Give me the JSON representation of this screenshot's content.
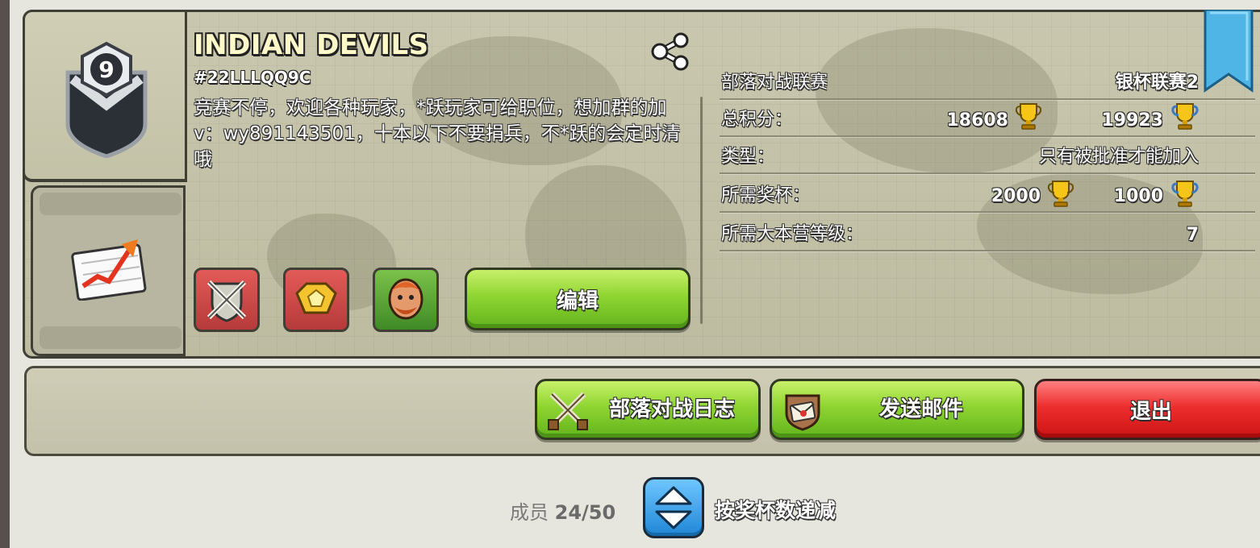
{
  "clan": {
    "level": "9",
    "name": "INDIAN DEVILS",
    "tag": "#22LLLQQ9C",
    "description": "竞赛不停，欢迎各种玩家，*跃玩家可给职位，想加群的加v：wy891143501，十本以下不要捐兵，不*跃的会定时清哦"
  },
  "actions": {
    "edit_label": "编辑",
    "war_log_label": "部落对战日志",
    "send_mail_label": "发送邮件",
    "leave_label": "退出"
  },
  "info": {
    "war_league_label": "部落对战联赛",
    "war_league_value": "银杯联赛2",
    "points_label": "总积分：",
    "points_trophies": "18608",
    "points_builder": "19923",
    "type_label": "类型：",
    "type_value": "只有被批准才能加入",
    "required_trophies_label": "所需奖杯：",
    "required_trophies": "2000",
    "required_builder_trophies": "1000",
    "required_th_label": "所需大本营等级：",
    "required_th_value": "7"
  },
  "footer": {
    "members_prefix": "成员",
    "members_count": "24/50",
    "sort_label": "按奖杯数递减"
  },
  "colors": {
    "green_button": "#8fd531",
    "red_button": "#ee2e2e",
    "panel": "#c9c7ae",
    "sort_button": "#1f86d6"
  },
  "icons": {
    "share": "share-icon",
    "stats": "stats-chart-icon",
    "trophy": "trophy-icon",
    "builder_trophy": "builder-trophy-icon",
    "war_perk": "crossed-swords-shield-icon",
    "league_perk": "gold-badge-icon",
    "troop_perk": "barbarian-icon",
    "mail": "mail-icon",
    "sort": "sort-arrows-icon"
  }
}
